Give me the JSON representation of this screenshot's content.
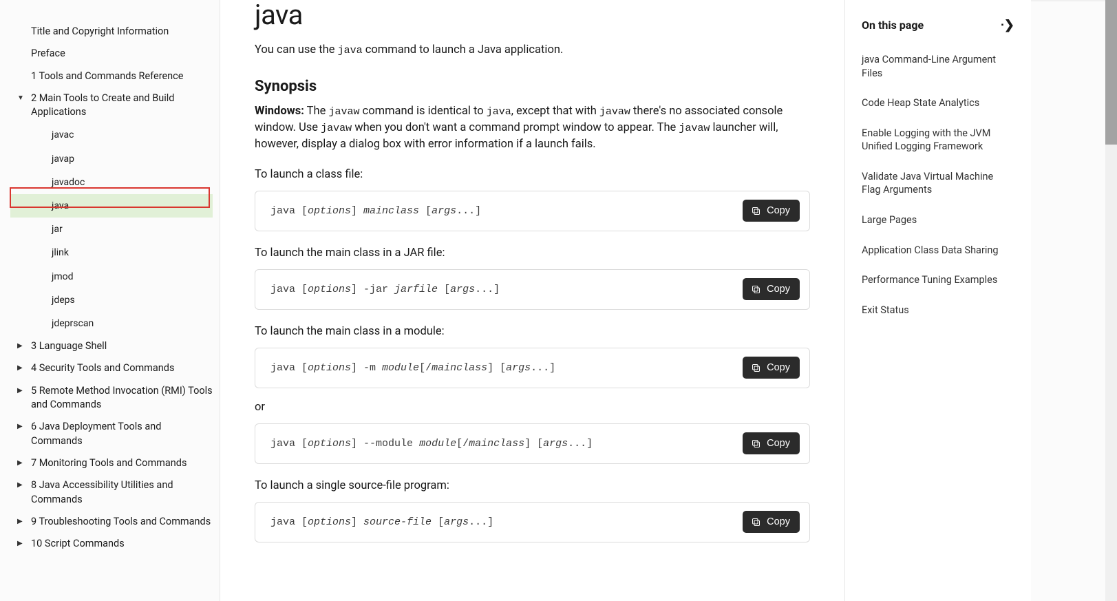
{
  "sidebar": {
    "top_items": [
      {
        "label": "Title and Copyright Information"
      },
      {
        "label": "Preface"
      },
      {
        "label": "1  Tools and Commands Reference"
      }
    ],
    "section2": {
      "label": "2  Main Tools to Create and Build Applications",
      "children": [
        "javac",
        "javap",
        "javadoc",
        "java",
        "jar",
        "jlink",
        "jmod",
        "jdeps",
        "jdeprscan"
      ],
      "active": "java"
    },
    "rest": [
      "3  Language Shell",
      "4  Security Tools and Commands",
      "5  Remote Method Invocation (RMI) Tools and Commands",
      "6  Java Deployment Tools and Commands",
      "7  Monitoring Tools and Commands",
      "8  Java Accessibility Utilities and Commands",
      "9  Troubleshooting Tools and Commands",
      "10  Script Commands"
    ]
  },
  "page": {
    "title": "java",
    "intro_pre": "You can use the ",
    "intro_code": "java",
    "intro_post": " command to launch a Java application.",
    "synopsis_heading": "Synopsis",
    "win_label": "Windows:",
    "win_1": " The ",
    "win_c1": "javaw",
    "win_2": " command is identical to ",
    "win_c2": "java",
    "win_3": ", except that with ",
    "win_c3": "javaw",
    "win_4": " there's no associated console window. Use ",
    "win_c4": "javaw",
    "win_5": " when you don't want a command prompt window to appear. The ",
    "win_c5": "javaw",
    "win_6": " launcher will, however, display a dialog box with error information if a launch fails.",
    "labels": {
      "classfile": "To launch a class file:",
      "jar": "To launch the main class in a JAR file:",
      "module": "To launch the main class in a module:",
      "or": "or",
      "single": "To launch a single source-file program:"
    },
    "snippets": {
      "classfile": {
        "p1": "java [",
        "i1": "options",
        "p2": "] ",
        "i2": "mainclass",
        "p3": " [",
        "i3": "args",
        "p4": "...]"
      },
      "jar": {
        "p1": "java [",
        "i1": "options",
        "p2": "] -jar ",
        "i2": "jarfile",
        "p3": " [",
        "i3": "args",
        "p4": "...]"
      },
      "module": {
        "p1": "java [",
        "i1": "options",
        "p2": "] -m ",
        "i2": "module",
        "p3": "[/",
        "i3": "mainclass",
        "p4": "] [",
        "i4": "args",
        "p5": "...]"
      },
      "module2": {
        "p1": "java [",
        "i1": "options",
        "p2": "] --module ",
        "i2": "module",
        "p3": "[/",
        "i3": "mainclass",
        "p4": "] [",
        "i4": "args",
        "p5": "...]"
      },
      "single": {
        "p1": "java [",
        "i1": "options",
        "p2": "] ",
        "i2": "source-file",
        "p3": " [",
        "i3": "args",
        "p4": "...]"
      }
    },
    "copy_label": "Copy"
  },
  "onthispage": {
    "heading": "On this page",
    "items": [
      "java Command-Line Argument Files",
      "Code Heap State Analytics",
      "Enable Logging with the JVM Unified Logging Framework",
      "Validate Java Virtual Machine Flag Arguments",
      "Large Pages",
      "Application Class Data Sharing",
      "Performance Tuning Examples",
      "Exit Status"
    ]
  }
}
